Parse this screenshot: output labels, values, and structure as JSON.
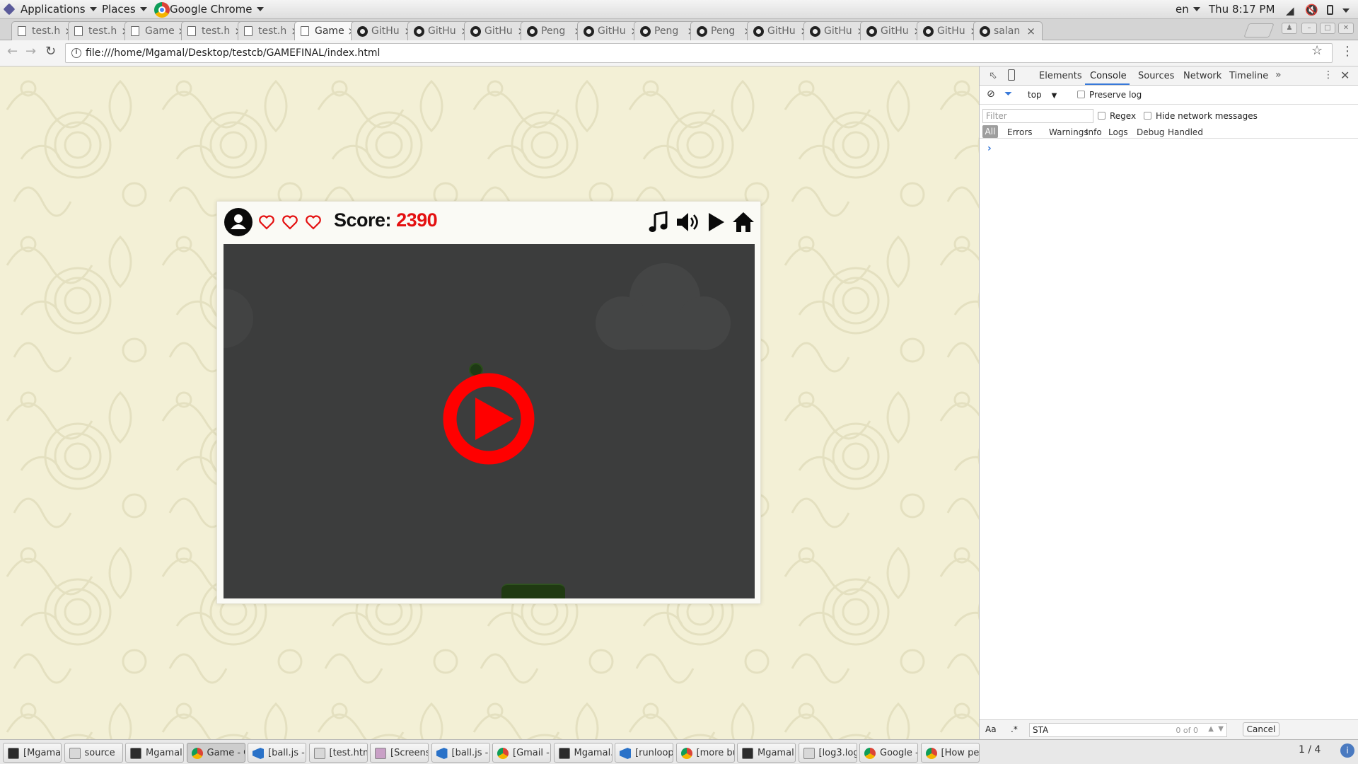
{
  "topbar": {
    "applications": "Applications",
    "places": "Places",
    "app_name": "Google Chrome",
    "lang": "en",
    "clock": "Thu  8:17 PM"
  },
  "tabs": [
    {
      "title": "test.h",
      "icon": "doc-icon"
    },
    {
      "title": "test.h",
      "icon": "doc-icon"
    },
    {
      "title": "Game",
      "icon": "doc-icon"
    },
    {
      "title": "test.h",
      "icon": "doc-icon"
    },
    {
      "title": "test.h",
      "icon": "doc-icon"
    },
    {
      "title": "Game",
      "icon": "doc-icon",
      "active": true
    },
    {
      "title": "GitHu",
      "icon": "github-icon"
    },
    {
      "title": "GitHu",
      "icon": "github-icon"
    },
    {
      "title": "GitHu",
      "icon": "github-icon"
    },
    {
      "title": "Peng",
      "icon": "github-icon"
    },
    {
      "title": "GitHu",
      "icon": "github-icon"
    },
    {
      "title": "Peng",
      "icon": "github-icon"
    },
    {
      "title": "Peng",
      "icon": "github-icon"
    },
    {
      "title": "GitHu",
      "icon": "github-icon"
    },
    {
      "title": "GitHu",
      "icon": "github-icon"
    },
    {
      "title": "GitHu",
      "icon": "github-icon"
    },
    {
      "title": "GitHu",
      "icon": "github-icon"
    },
    {
      "title": "salan",
      "icon": "github-icon"
    }
  ],
  "omnibox": {
    "url": "file:///home/Mgamal/Desktop/testcb/GAMEFINAL/index.html"
  },
  "game": {
    "score_label": "Score:",
    "score_value": "2390",
    "lives": 3,
    "accent_color": "#ff0000",
    "canvas_color": "#3c3d3d"
  },
  "devtools": {
    "tabs": [
      "Elements",
      "Console",
      "Sources",
      "Network",
      "Timeline"
    ],
    "active_tab": "Console",
    "context": "top",
    "preserve_log": "Preserve log",
    "filter_placeholder": "Filter",
    "regex": "Regex",
    "hide_network": "Hide network messages",
    "levels": [
      "All",
      "Errors",
      "Warnings",
      "Info",
      "Logs",
      "Debug",
      "Handled"
    ],
    "search": {
      "aa": "Aa",
      "regex_toggle": ".*",
      "value": "STA",
      "count": "0 of 0",
      "cancel": "Cancel"
    }
  },
  "taskbar": {
    "items": [
      {
        "label": "[Mgamal...",
        "icon": "terminal-icon"
      },
      {
        "label": "source",
        "icon": "files-icon"
      },
      {
        "label": "Mgamal...",
        "icon": "terminal-icon"
      },
      {
        "label": "Game - G...",
        "icon": "chrome-icon",
        "active": true
      },
      {
        "label": "[ball.js - ...",
        "icon": "vscode-icon"
      },
      {
        "label": "[test.htm...",
        "icon": "editor-icon"
      },
      {
        "label": "[Screensh...",
        "icon": "image-icon"
      },
      {
        "label": "[ball.js - ...",
        "icon": "vscode-icon"
      },
      {
        "label": "[Gmail - ...",
        "icon": "chrome-icon"
      },
      {
        "label": "Mgamal...",
        "icon": "terminal-icon"
      },
      {
        "label": "[runloop.j...",
        "icon": "vscode-icon"
      },
      {
        "label": "[more bu...",
        "icon": "chrome-icon"
      },
      {
        "label": "Mgamal...",
        "icon": "terminal-icon"
      },
      {
        "label": "[log3.log...",
        "icon": "editor-icon"
      },
      {
        "label": "Google -...",
        "icon": "chrome-icon"
      },
      {
        "label": "[How pe...",
        "icon": "chrome-icon"
      }
    ],
    "workspace": "1 / 4"
  }
}
